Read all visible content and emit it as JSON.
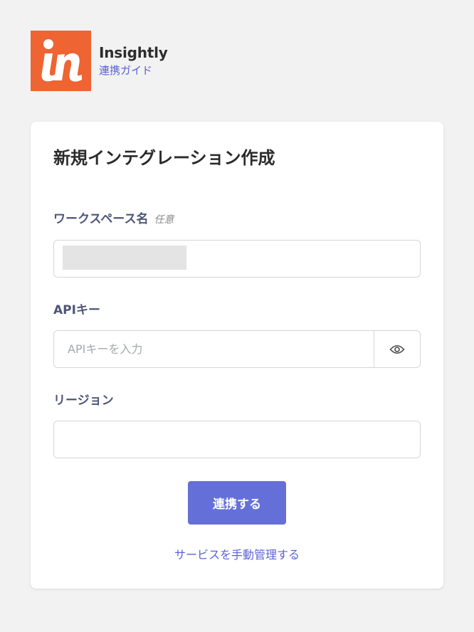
{
  "header": {
    "logo_icon": "insightly-logo-icon",
    "logo_color": "#ee6432",
    "brand_name": "Insightly",
    "guide_link": "連携ガイド"
  },
  "card": {
    "title": "新規インテグレーション作成",
    "workspace": {
      "label": "ワークスペース名",
      "optional_label": "任意",
      "value_masked": true
    },
    "api_key": {
      "label": "APIキー",
      "placeholder": "APIキーを入力",
      "value": "",
      "toggle_icon": "eye-icon"
    },
    "region": {
      "label": "リージョン",
      "value": ""
    },
    "connect_button": "連携する",
    "manual_link": "サービスを手動管理する"
  },
  "colors": {
    "accent": "#6470d8",
    "link": "#5a63d2",
    "label": "#4d5678",
    "background": "#f2f2f2"
  }
}
